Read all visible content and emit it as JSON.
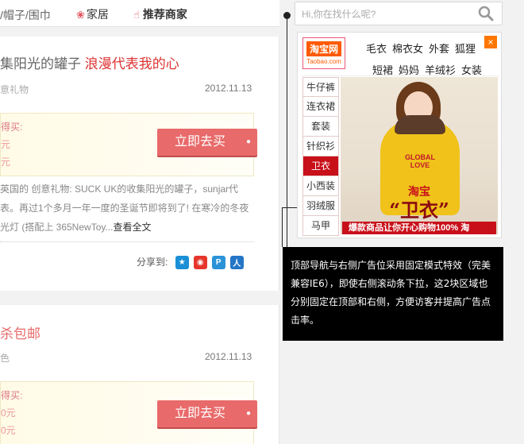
{
  "topnav": {
    "category": "/帽子/围巾",
    "home": "家居",
    "recommend": "推荐商家"
  },
  "search": {
    "placeholder": "Hi,你在找什么呢?"
  },
  "posts": [
    {
      "title_prefix": "集阳光的罐子",
      "title_highlight": "浪漫代表我的心",
      "meta": "意礼物",
      "date": "2012.11.13",
      "price_label": "得买:",
      "price_line1": "元",
      "price_line2": "元",
      "buy_label": "立即去买",
      "description": "英国的 创意礼物: SUCK UK的收集阳光的罐子，sunjar代表。再过1个多月一年一度的圣诞节即将到了! 在寒冷的冬夜光灯 (搭配上 365NewToy...",
      "read_more": "查看全文",
      "share_label": "分享到:"
    },
    {
      "title": "杀包邮",
      "meta": "色",
      "date": "2012.11.13",
      "price_label": "得买:",
      "price_line1": "0元",
      "price_line2": "0元",
      "buy_label": "立即去买"
    }
  ],
  "ad": {
    "logo_cn": "淘宝网",
    "logo_en": "Taobao.com",
    "close": "×",
    "tags_row1": [
      "毛衣",
      "棉衣女",
      "外套",
      "狐狸"
    ],
    "tags_row2": [
      "短裙",
      "妈妈",
      "羊绒衫",
      "女装"
    ],
    "categories": [
      "牛仔裤",
      "连衣裙",
      "套装",
      "针织衫",
      "卫衣",
      "小西装",
      "羽绒服",
      "马甲"
    ],
    "active_category": "卫衣",
    "print_text": "GLOBAL LOVE",
    "brand": "淘宝",
    "headline": "“卫衣”",
    "slogan": "爆款商品让你开心购物100%  淘"
  },
  "tooltip": {
    "text": "顶部导航与右侧广告位采用固定模式特效（完美兼容IE6），即使右侧滚动条下拉，这2块区域也分别固定在顶部和右侧，方便访客并提高广告点击率。"
  },
  "colors": {
    "accent": "#e86a6a",
    "title_red": "#dd3333",
    "taobao_orange": "#ff5a00",
    "active_tab": "#c8101a"
  }
}
